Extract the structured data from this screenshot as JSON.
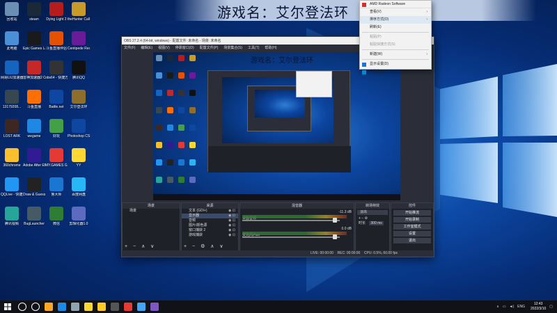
{
  "desktop": {
    "title": "游戏名：艾尔登法环",
    "icons": [
      {
        "label": "回收站",
        "color": "#6b8fb3"
      },
      {
        "label": "steam",
        "color": "#1b2838"
      },
      {
        "label": "Dying Light 2",
        "color": "#b71c1c"
      },
      {
        "label": "theHunter Call of t...",
        "color": "#c79a2a"
      },
      {
        "label": "此电脑",
        "color": "#4a90d9"
      },
      {
        "label": "Epic Games Launcher",
        "color": "#1a1a1a"
      },
      {
        "label": "斗鱼直播伴侣",
        "color": "#e65100"
      },
      {
        "label": "Centipede Recharged",
        "color": "#6a1b9a"
      },
      {
        "label": "网易UU加速器",
        "color": "#1565c0"
      },
      {
        "label": "雷神加速器2 Curious Ex...",
        "color": "#c62828"
      },
      {
        "label": "obs64 - 快捷方式",
        "color": "#333333"
      },
      {
        "label": "腾讯QQ",
        "color": "#111111"
      },
      {
        "label": "13179208...",
        "color": "#37474f"
      },
      {
        "label": "斗鱼直播",
        "color": "#ff6f00"
      },
      {
        "label": "Battle.net",
        "color": "#0d47a1"
      },
      {
        "label": "艾尔登法环",
        "color": "#8d6e2a"
      },
      {
        "label": "LOST ARK",
        "color": "#3e2723"
      },
      {
        "label": "wegame",
        "color": "#1e88e5"
      },
      {
        "label": "好玩",
        "color": "#43a047"
      },
      {
        "label": "Photoshop CS6",
        "color": "#0d47a1"
      },
      {
        "label": "360chrome",
        "color": "#fbc02d"
      },
      {
        "label": "Adobe After Effects CC",
        "color": "#311b92"
      },
      {
        "label": "MY.GAMES GameCenter",
        "color": "#e53935"
      },
      {
        "label": "YY",
        "color": "#fdd835"
      },
      {
        "label": "QQLive - 快捷方式",
        "color": "#2196f3"
      },
      {
        "label": "Draw & Guess",
        "color": "#222222"
      },
      {
        "label": "鲁大师",
        "color": "#1976d2"
      },
      {
        "label": "百度网盘",
        "color": "#29b6f6"
      },
      {
        "label": "腾讯视频",
        "color": "#26a69a"
      },
      {
        "label": "BugLauncher",
        "color": "#455a64"
      },
      {
        "label": "微信",
        "color": "#2e7d32"
      },
      {
        "label": "剪辑化器1.0",
        "color": "#5c6bc0"
      }
    ]
  },
  "obs": {
    "title": "OBS 27.2.4 (64-bit, windows) - 配置文件: 未命名 - 场景: 未命名",
    "window_buttons": [
      "—",
      "□",
      "✕"
    ],
    "menu": [
      "文件(F)",
      "编辑(E)",
      "视图(V)",
      "停靠窗口(D)",
      "配置文件(P)",
      "场景集合(S)",
      "工具(T)",
      "帮助(H)"
    ],
    "preview_title": "游戏名：艾尔登法环",
    "docks": {
      "scenes": {
        "header": "场景",
        "items": [
          "场景"
        ]
      },
      "sources": {
        "header": "来源",
        "items": [
          "文本 (GDI+)",
          "显示器",
          "音频",
          "图片/颜色源",
          "窗口捕获 2",
          "游戏捕获"
        ]
      },
      "mixer": {
        "header": "混音器",
        "channels": [
          {
            "name": "桌面音频",
            "db": "-11.3 dB"
          },
          {
            "name": "麦克风/Aux",
            "db": "0.0 dB"
          }
        ]
      },
      "transitions": {
        "header": "转场特效",
        "type": "淡出",
        "duration_label": "时长",
        "duration": "300 ms"
      },
      "controls": {
        "header": "控件",
        "buttons": [
          "开始推流",
          "开始录制",
          "工作室模式",
          "设置",
          "退出"
        ]
      }
    },
    "status": {
      "live": "LIVE: 00:00:00",
      "rec": "REC: 00:00:00",
      "cpu": "CPU: 0.5%, 60.00 fps"
    }
  },
  "context_menu": {
    "header": "AMD Radeon Software",
    "items": [
      {
        "label": "查看(V)",
        "submenu": true,
        "disabled": false
      },
      {
        "label": "排序方式(O)",
        "submenu": true,
        "disabled": false,
        "highlight": true
      },
      {
        "label": "刷新(E)",
        "submenu": false,
        "disabled": false
      },
      {
        "sep": true
      },
      {
        "label": "粘贴(P)",
        "submenu": false,
        "disabled": true
      },
      {
        "label": "粘贴快捷方式(S)",
        "submenu": false,
        "disabled": true
      },
      {
        "sep": true
      },
      {
        "label": "新建(W)",
        "submenu": true,
        "disabled": false
      },
      {
        "sep": true
      },
      {
        "label": "显示设置(D)",
        "submenu": false,
        "disabled": false
      },
      {
        "label": "个性化(R)",
        "submenu": false,
        "disabled": false
      }
    ]
  },
  "taskbar": {
    "start_icon": "windows-logo-icon",
    "apps": [
      {
        "name": "search-icon",
        "color": "#ffffff"
      },
      {
        "name": "taskview-icon",
        "color": "#ffffff"
      },
      {
        "name": "file-explorer-icon",
        "color": "#f9a825"
      },
      {
        "name": "edge-icon",
        "color": "#1e88e5"
      },
      {
        "name": "steam-icon",
        "color": "#90a4ae"
      },
      {
        "name": "qq-icon",
        "color": "#fdd835"
      },
      {
        "name": "folder-icon",
        "color": "#ffca28"
      },
      {
        "name": "obs-icon",
        "color": "#555555"
      },
      {
        "name": "game-icon",
        "color": "#e53935"
      },
      {
        "name": "app-icon",
        "color": "#42a5f5"
      },
      {
        "name": "app2-icon",
        "color": "#7e57c2"
      }
    ],
    "tray": {
      "lang": "ENG",
      "time": "12:43",
      "date": "2022/3/10"
    }
  }
}
